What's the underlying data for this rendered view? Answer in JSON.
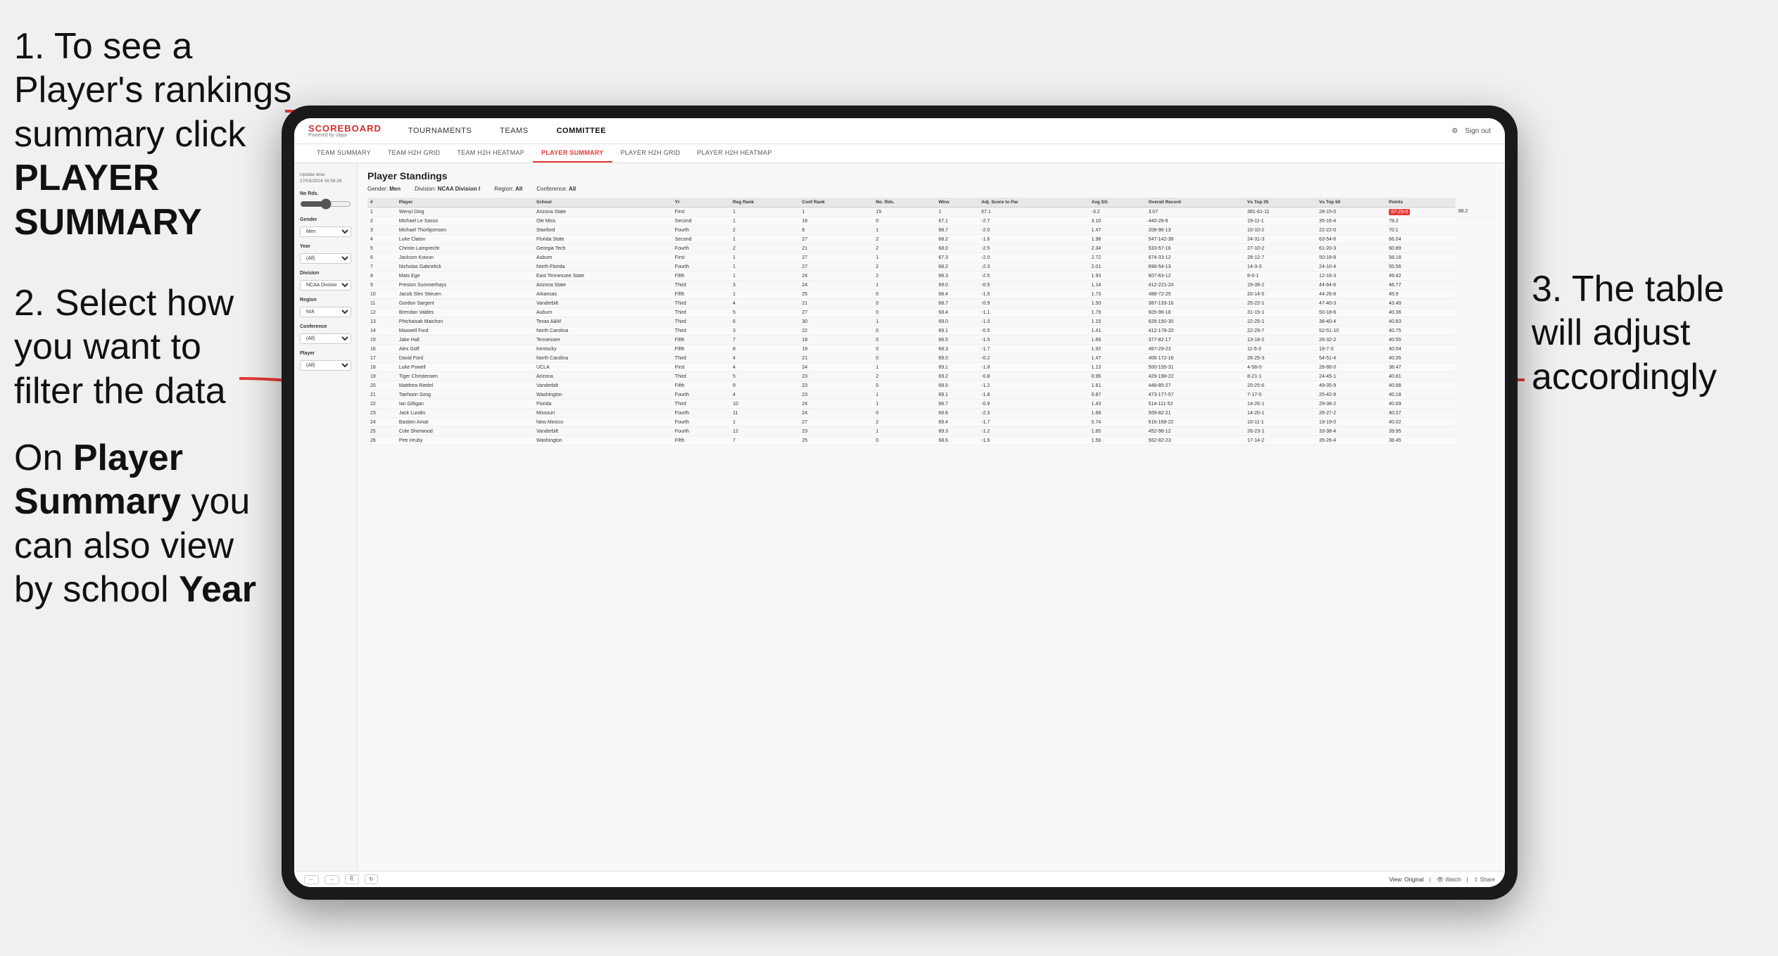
{
  "instructions": {
    "step1": "1. To see a Player's rankings summary click ",
    "step1_bold": "PLAYER SUMMARY",
    "step2_title": "2. Select how you want to filter the data",
    "step3_title": "3. The table will adjust accordingly",
    "bottom_note_pre": "On ",
    "bottom_bold1": "Player Summary",
    "bottom_note_mid": " you can also view by school ",
    "bottom_bold2": "Year"
  },
  "header": {
    "logo": "SCOREBOARD",
    "logo_sub": "Powered by clippi",
    "nav": [
      "TOURNAMENTS",
      "TEAMS",
      "COMMITTEE"
    ],
    "sign_out": "Sign out"
  },
  "sub_nav": {
    "items": [
      "TEAM SUMMARY",
      "TEAM H2H GRID",
      "TEAM H2H HEATMAP",
      "PLAYER SUMMARY",
      "PLAYER H2H GRID",
      "PLAYER H2H HEATMAP"
    ],
    "active": "PLAYER SUMMARY"
  },
  "filters": {
    "update_label": "Update time:",
    "update_time": "27/03/2024 16:56:26",
    "no_rds_label": "No Rds.",
    "gender_label": "Gender",
    "gender_value": "Men",
    "year_label": "Year",
    "year_value": "(All)",
    "division_label": "Division",
    "division_value": "NCAA Division I",
    "region_label": "Region",
    "region_value": "N/A",
    "conference_label": "Conference",
    "conference_value": "(All)",
    "player_label": "Player",
    "player_value": "(All)"
  },
  "table": {
    "title": "Player Standings",
    "gender_label": "Gender:",
    "gender_val": "Men",
    "division_label": "Division:",
    "division_val": "NCAA Division I",
    "region_label": "Region:",
    "region_val": "All",
    "conference_label": "Conference:",
    "conference_val": "All",
    "columns": [
      "#",
      "Player",
      "School",
      "Yr",
      "Reg Rank",
      "Conf Rank",
      "No. Rds.",
      "Wins",
      "Adj. Score to Par",
      "Avg SG",
      "Overall Record",
      "Vs Top 25",
      "Vs Top 50",
      "Points"
    ],
    "rows": [
      [
        "1",
        "Wenyi Ding",
        "Arizona State",
        "First",
        "1",
        "1",
        "15",
        "1",
        "67.1",
        "-3.2",
        "3.07",
        "381-61-11",
        "28-15-0",
        "57-23-0",
        "88.2"
      ],
      [
        "2",
        "Michael Le Sasso",
        "Ole Miss",
        "Second",
        "1",
        "18",
        "0",
        "67.1",
        "-2.7",
        "3.10",
        "440-26-6",
        "19-11-1",
        "35-16-4",
        "78.2"
      ],
      [
        "3",
        "Michael Thorbjornsen",
        "Stanford",
        "Fourth",
        "2",
        "8",
        "1",
        "68.7",
        "-2.0",
        "1.47",
        "208-96-13",
        "10-10-2",
        "22-22-0",
        "70.1"
      ],
      [
        "4",
        "Luke Claton",
        "Florida State",
        "Second",
        "1",
        "27",
        "2",
        "68.2",
        "-1.6",
        "1.98",
        "547-142-38",
        "24-31-3",
        "63-54-6",
        "66.04"
      ],
      [
        "5",
        "Christo Lamprecht",
        "Georgia Tech",
        "Fourth",
        "2",
        "21",
        "2",
        "68.0",
        "-2.5",
        "2.34",
        "533-57-16",
        "27-10-2",
        "61-20-3",
        "60.89"
      ],
      [
        "6",
        "Jackson Koivun",
        "Auburn",
        "First",
        "1",
        "27",
        "1",
        "67.3",
        "-2.0",
        "2.72",
        "674-33-12",
        "28-12-7",
        "50-19-8",
        "58.18"
      ],
      [
        "7",
        "Nicholas Gabrielick",
        "North Florida",
        "Fourth",
        "1",
        "27",
        "2",
        "68.2",
        "-2.3",
        "2.01",
        "698-54-13",
        "14-3-3",
        "24-10-4",
        "55.56"
      ],
      [
        "8",
        "Mats Ege",
        "East Tennessee State",
        "Fifth",
        "1",
        "24",
        "2",
        "68.3",
        "-2.5",
        "1.93",
        "607-63-12",
        "8-6-1",
        "12-16-3",
        "49.42"
      ],
      [
        "9",
        "Preston Summerhays",
        "Arizona State",
        "Third",
        "3",
        "24",
        "1",
        "69.0",
        "-0.5",
        "1.14",
        "412-221-24",
        "19-39-2",
        "44-64-6",
        "46.77"
      ],
      [
        "10",
        "Jacob Slev Stieuen",
        "Arkansas",
        "Fifth",
        "1",
        "25",
        "0",
        "68.4",
        "-1.5",
        "1.73",
        "488-72-25",
        "20-14-5",
        "44-26-8",
        "45.9"
      ],
      [
        "11",
        "Gordon Sargent",
        "Vanderbilt",
        "Third",
        "4",
        "21",
        "0",
        "68.7",
        "-0.9",
        "1.50",
        "387-133-16",
        "25-22-1",
        "47-40-3",
        "43.49"
      ],
      [
        "12",
        "Brendan Valdes",
        "Auburn",
        "Third",
        "5",
        "27",
        "0",
        "68.4",
        "-1.1",
        "1.79",
        "605-96-18",
        "31-15-1",
        "50-18-6",
        "40.36"
      ],
      [
        "13",
        "Phichaisak Maichon",
        "Texas A&M",
        "Third",
        "6",
        "30",
        "1",
        "69.0",
        "-1.0",
        "1.15",
        "628-150-30",
        "22-25-1",
        "38-40-4",
        "40.83"
      ],
      [
        "14",
        "Maxwell Ford",
        "North Carolina",
        "Third",
        "3",
        "22",
        "0",
        "69.1",
        "-0.5",
        "1.41",
        "412-178-20",
        "22-29-7",
        "52-51-10",
        "40.75"
      ],
      [
        "15",
        "Jake Hall",
        "Tennessee",
        "Fifth",
        "7",
        "18",
        "0",
        "68.5",
        "-1.5",
        "1.66",
        "377-82-17",
        "13-18-2",
        "26-32-2",
        "40.55"
      ],
      [
        "16",
        "Alex Goff",
        "Kentucky",
        "Fifth",
        "8",
        "19",
        "0",
        "68.3",
        "-1.7",
        "1.92",
        "467-29-23",
        "11-5-3",
        "18-7-3",
        "40.54"
      ],
      [
        "17",
        "David Ford",
        "North Carolina",
        "Third",
        "4",
        "21",
        "0",
        "69.0",
        "-0.2",
        "1.47",
        "406-172-16",
        "26-25-3",
        "54-51-4",
        "40.35"
      ],
      [
        "18",
        "Luke Powell",
        "UCLA",
        "First",
        "4",
        "24",
        "1",
        "69.1",
        "-1.8",
        "1.13",
        "500-155-31",
        "4-58-0",
        "28-88-0",
        "38.47"
      ],
      [
        "19",
        "Tiger Christensen",
        "Arizona",
        "Third",
        "5",
        "23",
        "2",
        "69.2",
        "-0.8",
        "0.96",
        "429-198-22",
        "8-21-1",
        "24-45-1",
        "40.81"
      ],
      [
        "20",
        "Matthew Riedel",
        "Vanderbilt",
        "Fifth",
        "9",
        "23",
        "0",
        "68.5",
        "-1.2",
        "1.61",
        "448-85-27",
        "20-25-6",
        "49-35-9",
        "40.98"
      ],
      [
        "21",
        "Taehoon Song",
        "Washington",
        "Fourth",
        "4",
        "23",
        "1",
        "69.1",
        "-1.8",
        "0.87",
        "473-177-57",
        "7-17-5",
        "25-42-9",
        "40.18"
      ],
      [
        "22",
        "Ian Gilligan",
        "Florida",
        "Third",
        "10",
        "24",
        "1",
        "68.7",
        "-0.9",
        "1.43",
        "514-111-52",
        "14-26-1",
        "29-38-2",
        "40.69"
      ],
      [
        "23",
        "Jack Lundin",
        "Missouri",
        "Fourth",
        "11",
        "24",
        "0",
        "68.6",
        "-2.3",
        "1.68",
        "509-82-21",
        "14-20-1",
        "26-27-2",
        "40.27"
      ],
      [
        "24",
        "Bastien Amat",
        "New Mexico",
        "Fourth",
        "1",
        "27",
        "2",
        "69.4",
        "-1.7",
        "0.74",
        "616-168-22",
        "10-11-1",
        "19-19-0",
        "40.02"
      ],
      [
        "25",
        "Cole Sherwood",
        "Vanderbilt",
        "Fourth",
        "12",
        "23",
        "1",
        "69.3",
        "-1.2",
        "1.65",
        "452-96-12",
        "26-23-1",
        "33-38-4",
        "39.95"
      ],
      [
        "26",
        "Petr Hruby",
        "Washington",
        "Fifth",
        "7",
        "25",
        "0",
        "68.6",
        "-1.6",
        "1.56",
        "562-82-23",
        "17-14-2",
        "35-26-4",
        "38.45"
      ]
    ]
  },
  "toolbar": {
    "view_label": "View: Original",
    "watch_label": "Watch",
    "share_label": "Share"
  }
}
